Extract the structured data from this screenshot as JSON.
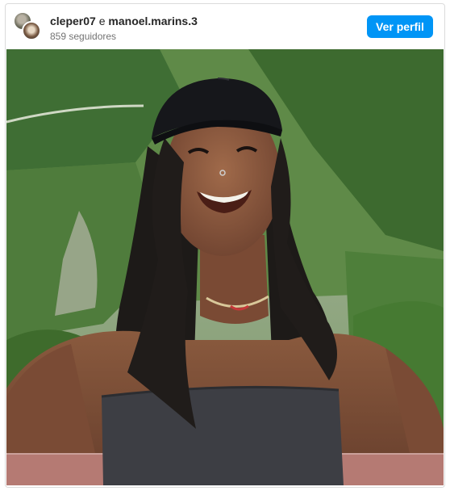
{
  "post": {
    "author_1": "cleper07",
    "connector": "e",
    "author_2": "manoel.marins.3",
    "followers": "859 seguidores",
    "follow_label": "Ver perfil"
  },
  "colors": {
    "accent": "#0095f6",
    "text": "#262626",
    "muted": "#737373"
  }
}
